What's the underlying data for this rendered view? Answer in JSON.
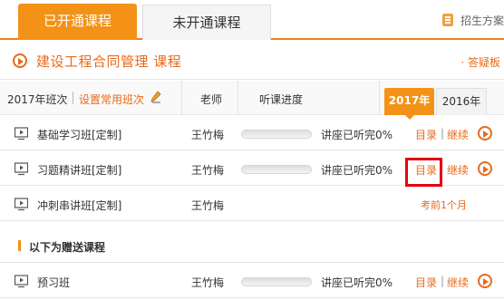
{
  "tabs": {
    "active": "已开通课程",
    "inactive": "未开通课程"
  },
  "top_right": {
    "label": "招生方案"
  },
  "course": {
    "title": "建设工程合同管理  课程",
    "answer_board": "· 答疑板"
  },
  "subheader": {
    "class_year": "2017年班次",
    "setting_link": "设置常用班次",
    "teacher": "老师",
    "progress": "听课进度",
    "year_active": "2017年",
    "year_inactive": "2016年"
  },
  "rows": [
    {
      "name": "基础学习班[定制]",
      "teacher": "王竹梅",
      "progress": 0,
      "status": "讲座已听完0%",
      "catalog": "目录",
      "pipe": "|",
      "continue": "继续"
    },
    {
      "name": "习题精讲班[定制]",
      "teacher": "王竹梅",
      "progress": 0,
      "status": "讲座已听完0%",
      "catalog": "目录",
      "continue": "继续"
    },
    {
      "name": "冲刺串讲班[定制]",
      "teacher": "王竹梅",
      "note": "考前1个月"
    }
  ],
  "gift": {
    "title": "以下为赠送课程",
    "rows": [
      {
        "name": "预习班",
        "teacher": "王竹梅",
        "progress": 0,
        "status": "讲座已听完0%",
        "catalog": "目录",
        "pipe": "|",
        "continue": "继续"
      }
    ]
  },
  "colors": {
    "accent": "#f39216",
    "link": "#e86a1a",
    "highlight": "#e3000f"
  }
}
